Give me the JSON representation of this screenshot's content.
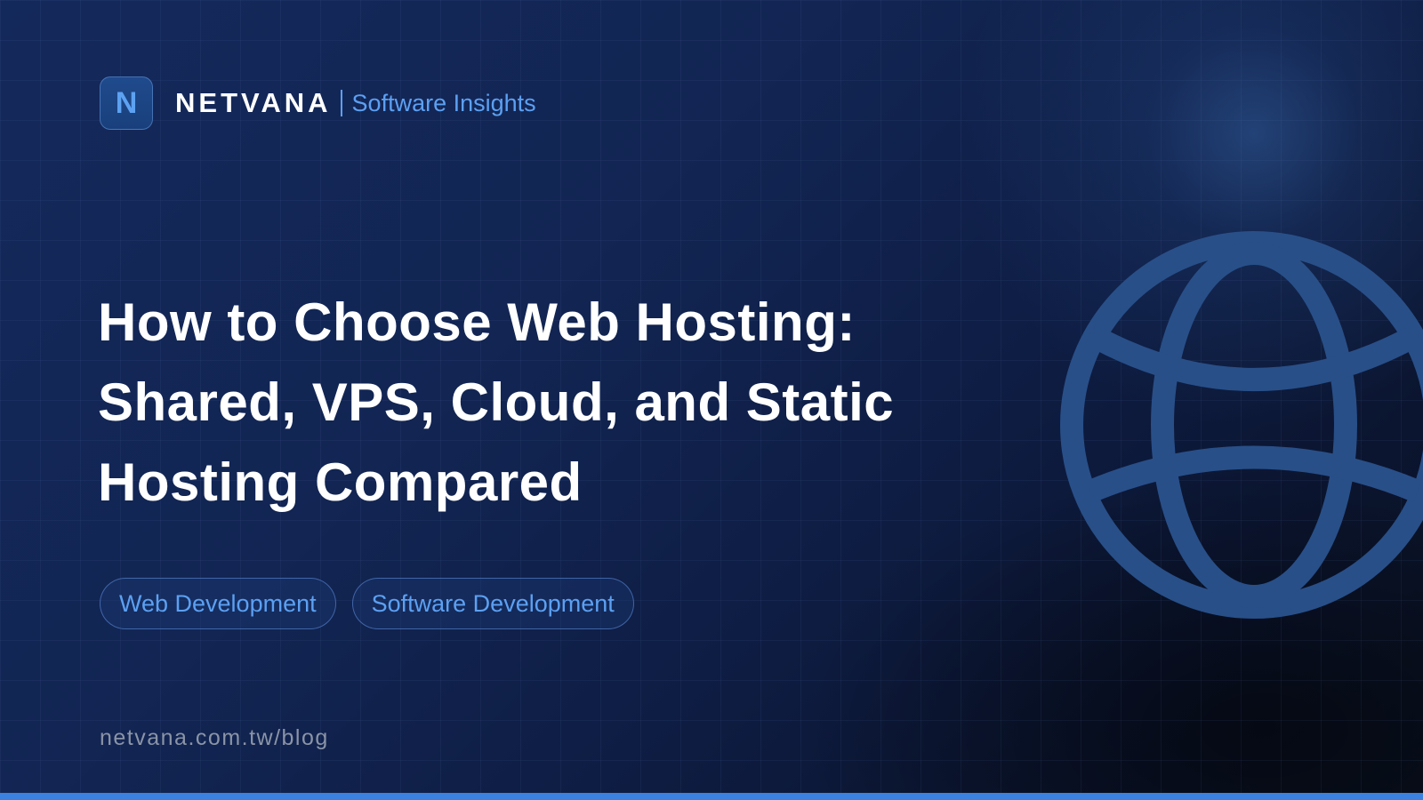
{
  "brand": {
    "logo_letter": "N",
    "name": "NETVANA",
    "tagline": "Software Insights"
  },
  "title_lines": [
    "How to Choose Web Hosting:",
    "Shared, VPS, Cloud, and Static",
    "Hosting Compared"
  ],
  "tags": [
    "Web Development",
    "Software Development"
  ],
  "url": "netvana.com.tw/blog",
  "decorations": {
    "icon": "globe-icon"
  },
  "colors": {
    "accent": "#5ca0f2",
    "title": "#ffffff",
    "url": "#8a94a6",
    "bottom_bar": "#3b82e0",
    "globe": "#284f88"
  }
}
